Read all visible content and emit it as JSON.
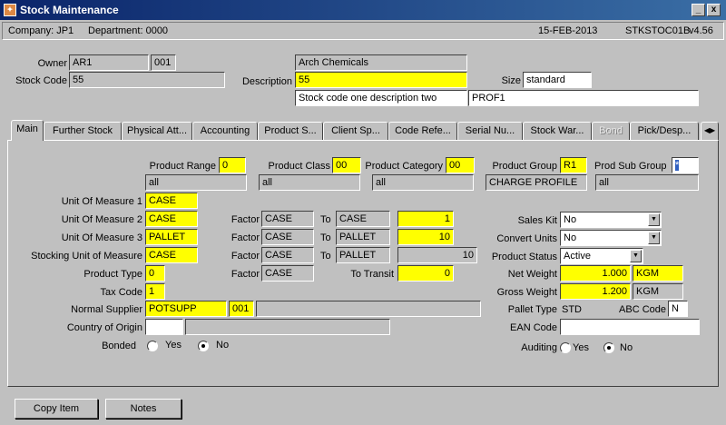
{
  "window": {
    "title": "Stock Maintenance",
    "minimize": "_",
    "close": "x"
  },
  "status": {
    "company": "Company: JP1",
    "department": "Department: 0000",
    "date": "15-FEB-2013",
    "form": "STKSTOC01B",
    "version": "v4.56"
  },
  "header": {
    "owner_label": "Owner",
    "owner": "AR1",
    "owner_code": "001",
    "owner_name": "Arch Chemicals",
    "stock_code_label": "Stock Code",
    "stock_code": "55",
    "description_label": "Description",
    "description": "55",
    "description2": "Stock code one description two",
    "profile": "PROF1",
    "size_label": "Size",
    "size": "standard"
  },
  "tabs": [
    {
      "label": "Main",
      "active": true
    },
    {
      "label": "Further Stock"
    },
    {
      "label": "Physical Att..."
    },
    {
      "label": "Accounting"
    },
    {
      "label": "Product S..."
    },
    {
      "label": "Client Sp..."
    },
    {
      "label": "Code Refe..."
    },
    {
      "label": "Serial Nu..."
    },
    {
      "label": "Stock War..."
    },
    {
      "label": "Bond",
      "disabled": true
    },
    {
      "label": "Pick/Desp..."
    }
  ],
  "product": {
    "range_label": "Product Range",
    "range": "0",
    "range_desc": "all",
    "class_label": "Product Class",
    "class": "00",
    "class_desc": "all",
    "category_label": "Product Category",
    "category": "00",
    "category_desc": "all",
    "group_label": "Product Group",
    "group": "R1",
    "group_desc": "CHARGE PROFILE",
    "subgroup_label": "Prod Sub Group",
    "subgroup": "*",
    "subgroup_desc": "all"
  },
  "uom": {
    "uom1_label": "Unit Of Measure 1",
    "uom1": "CASE",
    "uom2_label": "Unit Of Measure 2",
    "uom2": "CASE",
    "uom3_label": "Unit Of Measure 3",
    "uom3": "PALLET",
    "stocking_label": "Stocking Unit of Measure",
    "stocking": "CASE",
    "factor_label": "Factor",
    "to_label": "To",
    "f2_from": "CASE",
    "f2_to": "CASE",
    "f2_val": "1",
    "f3_from": "CASE",
    "f3_to": "PALLET",
    "f3_val": "10",
    "fs_from": "CASE",
    "fs_to": "PALLET",
    "fs_val": "10",
    "ft_from": "CASE",
    "transit_label": "To Transit",
    "transit": "0"
  },
  "details": {
    "product_type_label": "Product Type",
    "product_type": "0",
    "tax_code_label": "Tax Code",
    "tax_code": "1",
    "supplier_label": "Normal Supplier",
    "supplier": "POTSUPP",
    "supplier_code": "001",
    "supplier_name": "",
    "country_label": "Country of Origin",
    "country": "",
    "country_name": "",
    "bonded_label": "Bonded",
    "yes": "Yes",
    "no": "No"
  },
  "right": {
    "sales_kit_label": "Sales Kit",
    "sales_kit": "No",
    "convert_label": "Convert Units",
    "convert": "No",
    "status_label": "Product Status",
    "status": "Active",
    "net_weight_label": "Net Weight",
    "net_weight": "1.000",
    "net_unit": "KGM",
    "gross_weight_label": "Gross Weight",
    "gross_weight": "1.200",
    "gross_unit": "KGM",
    "pallet_type_label": "Pallet Type",
    "pallet_type": "STD",
    "abc_label": "ABC Code",
    "abc": "N",
    "ean_label": "EAN Code",
    "ean": "",
    "auditing_label": "Auditing"
  },
  "buttons": {
    "copy_item": "Copy Item",
    "notes": "Notes"
  }
}
